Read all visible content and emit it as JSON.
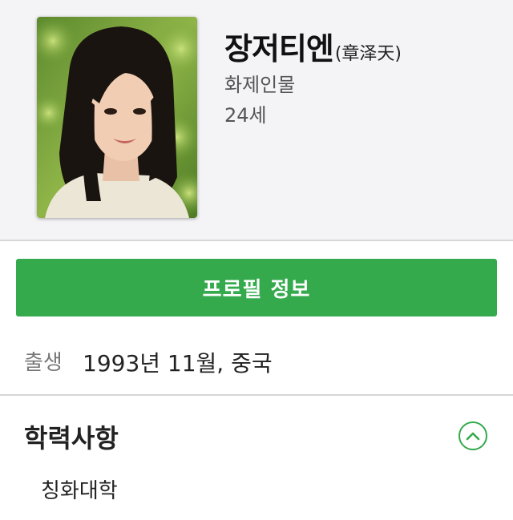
{
  "profile": {
    "name": "장저티엔",
    "hanja": "(章泽天)",
    "category": "화제인물",
    "age": "24세",
    "photo_alt": "profile-photo"
  },
  "profile_button": {
    "label": "프로필 정보"
  },
  "birth": {
    "label": "출생",
    "value": "1993년 11월, 중국"
  },
  "education": {
    "title": "학력사항",
    "items": [
      "칭화대학"
    ],
    "toggle_icon": "chevron-up-icon"
  },
  "colors": {
    "accent": "#34aa4c",
    "header_bg": "#f4f3f5"
  }
}
